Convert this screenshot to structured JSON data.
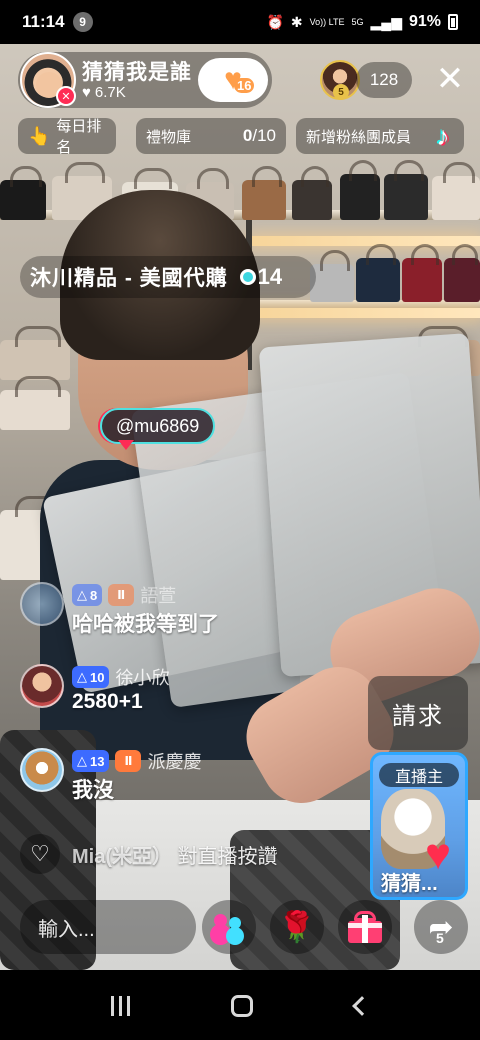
{
  "status_bar": {
    "time": "11:14",
    "notification_count": "9",
    "network_top": "Vo)) LTE",
    "network_5g": "5G",
    "battery": "91%"
  },
  "host": {
    "name": "猜猜我是誰",
    "likes": "6.7K",
    "follow_count": "16"
  },
  "viewers": {
    "top_rank": "5",
    "count": "128"
  },
  "chips": {
    "daily_rank": "每日排名",
    "gift_library": "禮物庫",
    "gift_progress_current": "0",
    "gift_progress_total": "/10",
    "new_fans": "新增粉絲團成員"
  },
  "shop": {
    "name": "沐川精品 - 美國代購",
    "number": "14"
  },
  "mention": "@mu6869",
  "comments": [
    {
      "level": "8",
      "username": "語萱",
      "text": "哈哈被我等到了"
    },
    {
      "level": "10",
      "username": "徐小欣",
      "text": "2580+1"
    },
    {
      "level": "13",
      "username": "派慶慶",
      "text": "我沒"
    }
  ],
  "like_notice": {
    "user": "Mia(米亞）",
    "text": "對直播按讚"
  },
  "request_button": "請求",
  "live_card": {
    "label": "直播主",
    "name": "猜猜..."
  },
  "bottom_bar": {
    "input_placeholder": "輸入...",
    "share_count": "5"
  },
  "colors": {
    "accent_pink": "#fe2c55",
    "accent_cyan": "#25f4ee",
    "level_badge": "#3d6bff",
    "fan_badge": "#ff7a3c",
    "follow_heart": "#ff9e4a"
  }
}
